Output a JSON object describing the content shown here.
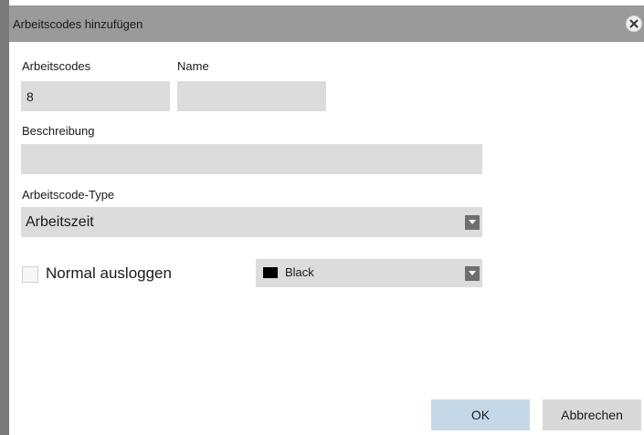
{
  "dialog": {
    "title": "Arbeitscodes hinzufügen"
  },
  "fields": {
    "code_label": "Arbeitscodes",
    "code_value": "8",
    "name_label": "Name",
    "name_value": "",
    "description_label": "Beschreibung",
    "description_value": "",
    "type_label": "Arbeitscode-Type",
    "type_value": "Arbeitszeit"
  },
  "options": {
    "logout_label": "Normal ausloggen",
    "logout_checked": false,
    "color_value": "Black",
    "color_swatch": "#000000"
  },
  "buttons": {
    "ok": "OK",
    "cancel": "Abbrechen"
  },
  "colors": {
    "ok_button": "#c5d8e8",
    "cancel_button": "#d9d9d9",
    "field_bg": "#dcdcdc",
    "titlebar": "#9a9a9a"
  }
}
